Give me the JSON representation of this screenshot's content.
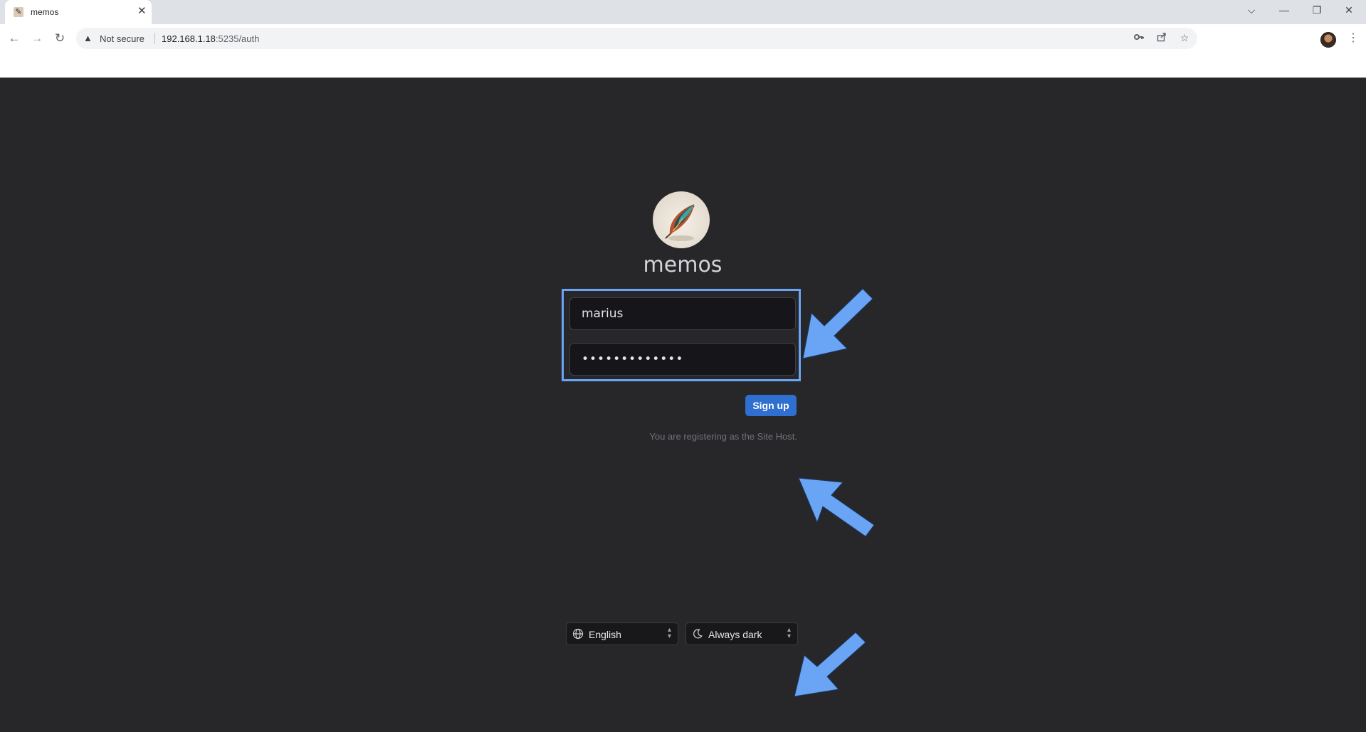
{
  "browser": {
    "tab_title": "memos",
    "tab_close": "✕",
    "security_label": "Not secure",
    "url_host": "192.168.1.18",
    "url_rest": ":5235/auth",
    "window_controls": {
      "tab_search": "⌵",
      "minimize": "—",
      "restore": "❐",
      "close": "✕"
    },
    "icons": [
      "back-icon",
      "forward-icon",
      "reload-icon",
      "warning-icon",
      "key-icon",
      "share-icon",
      "star-icon",
      "profile-avatar",
      "menu-icon"
    ]
  },
  "auth": {
    "app_name": "memos",
    "username_value": "marius",
    "password_value": "•••••••••••••",
    "signup_label": "Sign up",
    "hint": "You are registering as the Site Host."
  },
  "footer": {
    "language": "English",
    "theme": "Always dark"
  },
  "colors": {
    "page_bg": "#27272a",
    "highlight": "#6aa4f5",
    "button": "#2f6fcf"
  }
}
